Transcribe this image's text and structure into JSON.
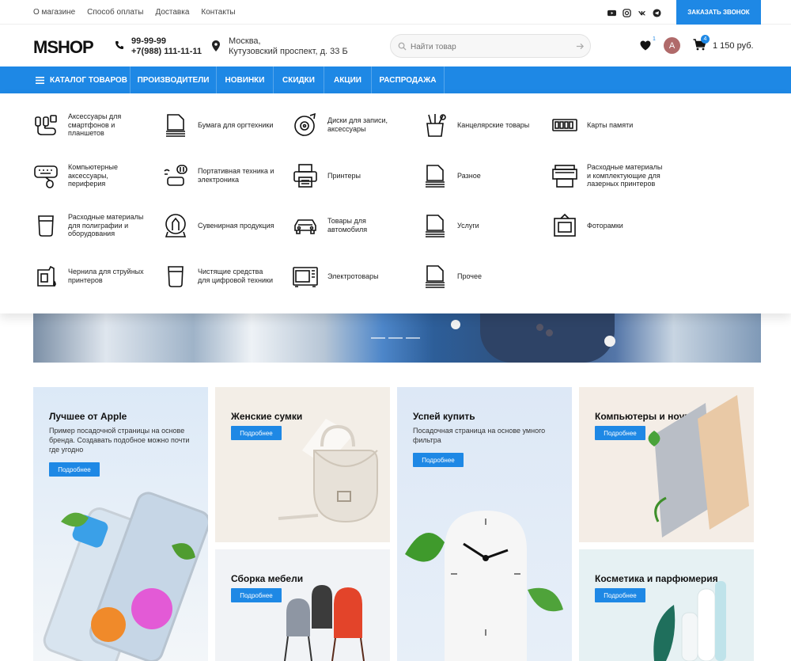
{
  "topbar": {
    "links": [
      "О магазине",
      "Способ оплаты",
      "Доставка",
      "Контакты"
    ],
    "callback": "ЗАКАЗАТЬ ЗВОНОК"
  },
  "header": {
    "logo": "MSHOP",
    "phone1": "99-99-99",
    "phone2": "+7(988) 111-11-11",
    "address_city": "Москва,",
    "address_street": "Кутузовский проспект, д. 33 Б",
    "search_placeholder": "Найти товар",
    "favorites_count": "1",
    "avatar_letter": "A",
    "cart_count": "4",
    "cart_total": "1 150 руб."
  },
  "nav": {
    "items": [
      "КАТАЛОГ ТОВАРОВ",
      "ПРОИЗВОДИТЕЛИ",
      "НОВИНКИ",
      "СКИДКИ",
      "АКЦИИ",
      "РАСПРОДАЖА"
    ]
  },
  "catalog": {
    "categories": [
      {
        "label": "Аксессуары для смартфонов и планшетов",
        "icon": "headphones-cable-icon"
      },
      {
        "label": "Бумага для оргтехники",
        "icon": "paper-stack-icon"
      },
      {
        "label": "Диски для записи, аксессуары",
        "icon": "disc-icon"
      },
      {
        "label": "Канцелярские товары",
        "icon": "stationery-icon"
      },
      {
        "label": "Карты памяти",
        "icon": "memory-card-icon"
      },
      {
        "label": "Компьютерные аксессуары, периферия",
        "icon": "keyboard-mouse-icon"
      },
      {
        "label": "Портативная техника и электроника",
        "icon": "portable-device-icon"
      },
      {
        "label": "Принтеры",
        "icon": "printer-icon"
      },
      {
        "label": "Разное",
        "icon": "stack-icon"
      },
      {
        "label": "Расходные материалы и комплектующие для лазерных принтеров",
        "icon": "laser-printer-icon"
      },
      {
        "label": "Расходные материалы для полиграфии и оборудования",
        "icon": "cup-icon"
      },
      {
        "label": "Сувенирная продукция",
        "icon": "snow-globe-icon"
      },
      {
        "label": "Товары для автомобиля",
        "icon": "car-icon"
      },
      {
        "label": "Услуги",
        "icon": "stack-icon"
      },
      {
        "label": "Фоторамки",
        "icon": "photo-frame-icon"
      },
      {
        "label": "Чернила для струйных принтеров",
        "icon": "ink-icon"
      },
      {
        "label": "Чистящие средства для цифровой техники",
        "icon": "cleaning-icon"
      },
      {
        "label": "Электротовары",
        "icon": "microwave-icon"
      },
      {
        "label": "Прочее",
        "icon": "stack-icon"
      }
    ]
  },
  "promos": [
    {
      "title": "Лучшее от Apple",
      "text": "Пример посадочной страницы на основе бренда. Создавать подобное можно почти где угодно",
      "button": "Подробнее"
    },
    {
      "title": "Женские сумки",
      "text": "",
      "button": "Подробнее"
    },
    {
      "title": "Успей купить",
      "text": "Посадочная страница на основе умного фильтра",
      "button": "Подробнее"
    },
    {
      "title": "Компьютеры и ноутбуки",
      "text": "",
      "button": "Подробнее"
    },
    {
      "title": "Сборка мебели",
      "text": "",
      "button": "Подробнее"
    },
    {
      "title": "Косметика и парфюмерия",
      "text": "",
      "button": "Подробнее"
    }
  ],
  "colors": {
    "accent": "#1e88e5"
  }
}
